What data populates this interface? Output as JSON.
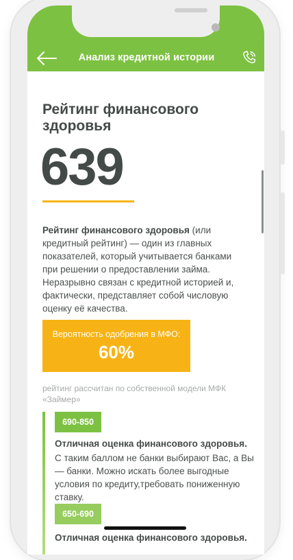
{
  "header": {
    "title": "Анализ кредитной истории",
    "background_color": "#7dc142",
    "back_icon": "arrow-left-icon",
    "call_icon": "phone-icon"
  },
  "rating": {
    "title": "Рейтинг финансового здоровья",
    "score": "639",
    "underline_color": "#f7b316"
  },
  "description": {
    "bold_lead": "Рейтинг финансового здоровья",
    "rest": " (или кредитный рейтинг) — один из главных показателей, который учитывается банками при решении о предоставлении займа. Неразрывно связан с кредитной историей и, фактически, представляет собой числовую оценку её качества."
  },
  "approval": {
    "label": "Вероятность одобрения в МФО:",
    "value": "60%",
    "background_color": "#f7b316"
  },
  "note": "рейтинг рассчитан по собственной модели МФК «Займер»",
  "ranges": [
    {
      "badge": "690-850",
      "color": "#7dc142",
      "title": "Отличная оценка финансового здоровья.",
      "text": "С таким баллом не банки выбирают Вас, а Вы — банки. Можно искать более выгодные условия по кредиту,требовать пониженную ставку."
    },
    {
      "badge": "650-690",
      "color": "#96cd5e",
      "title": "Отличная оценка финансового здоровья."
    }
  ]
}
